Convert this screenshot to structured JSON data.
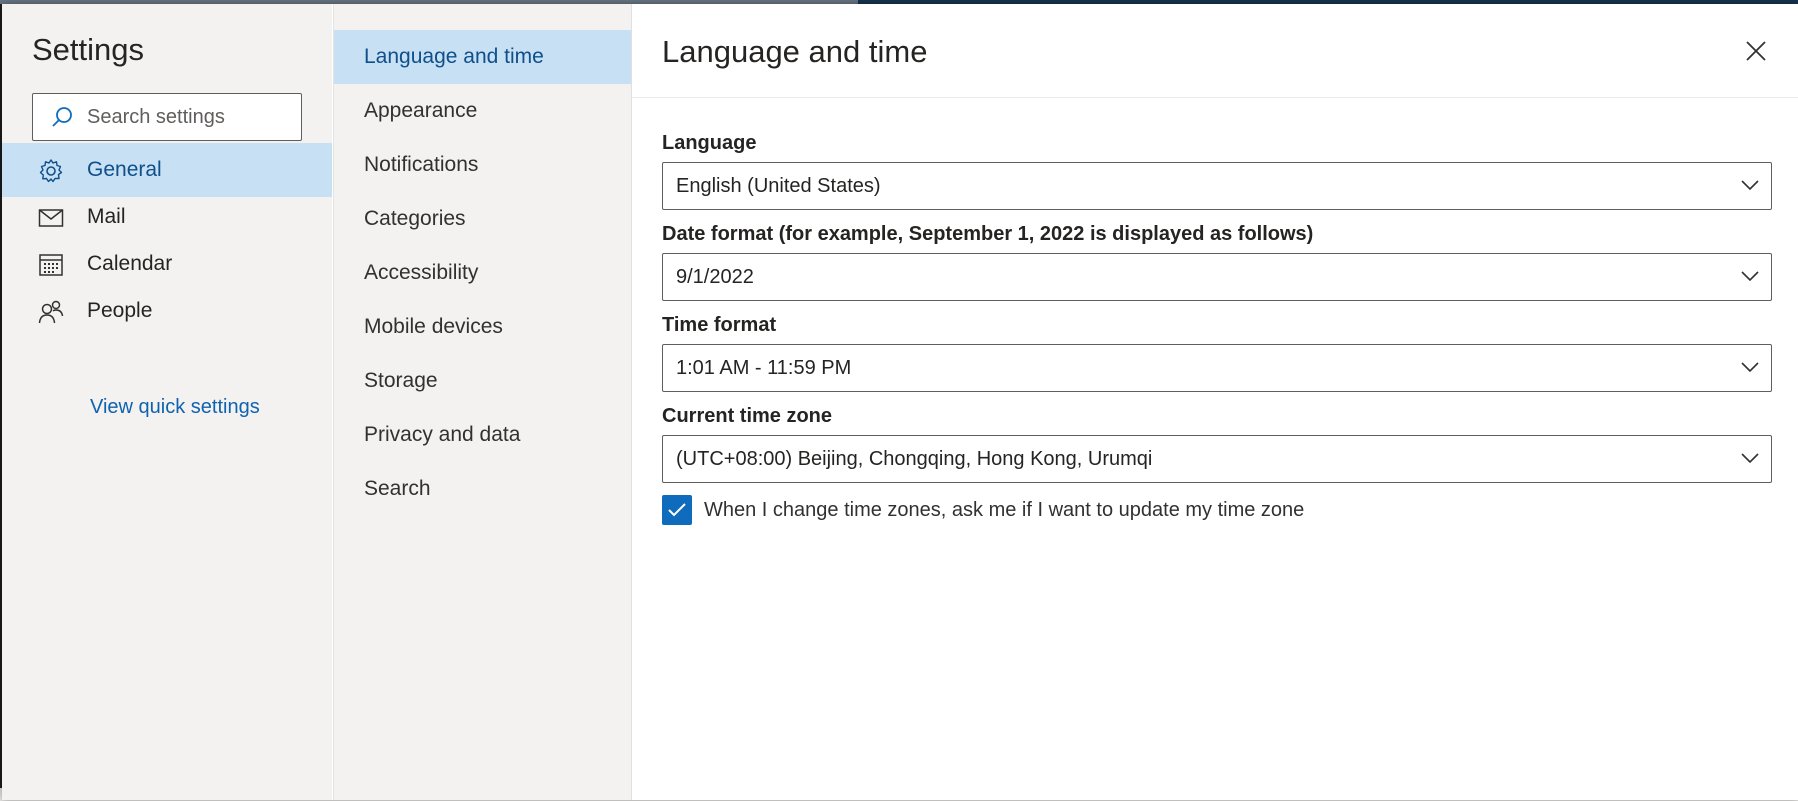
{
  "settings": {
    "title": "Settings",
    "search_placeholder": "Search settings"
  },
  "nav": {
    "items": [
      {
        "label": "General",
        "icon": "gear-icon",
        "selected": true
      },
      {
        "label": "Mail",
        "icon": "mail-icon",
        "selected": false
      },
      {
        "label": "Calendar",
        "icon": "calendar-icon",
        "selected": false
      },
      {
        "label": "People",
        "icon": "people-icon",
        "selected": false
      }
    ],
    "quick_settings_link": "View quick settings"
  },
  "subnav": {
    "items": [
      {
        "label": "Language and time",
        "selected": true
      },
      {
        "label": "Appearance",
        "selected": false
      },
      {
        "label": "Notifications",
        "selected": false
      },
      {
        "label": "Categories",
        "selected": false
      },
      {
        "label": "Accessibility",
        "selected": false
      },
      {
        "label": "Mobile devices",
        "selected": false
      },
      {
        "label": "Storage",
        "selected": false
      },
      {
        "label": "Privacy and data",
        "selected": false
      },
      {
        "label": "Search",
        "selected": false
      }
    ]
  },
  "pane": {
    "title": "Language and time",
    "language": {
      "label": "Language",
      "value": "English (United States)"
    },
    "date_format": {
      "label": "Date format (for example, September 1, 2022 is displayed as follows)",
      "value": "9/1/2022"
    },
    "time_format": {
      "label": "Time format",
      "value": "1:01 AM - 11:59 PM"
    },
    "time_zone": {
      "label": "Current time zone",
      "value": "(UTC+08:00) Beijing, Chongqing, Hong Kong, Urumqi"
    },
    "update_tz_checkbox": {
      "label": "When I change time zones, ask me if I want to update my time zone",
      "checked": true
    }
  },
  "colors": {
    "accent": "#0f6cbd",
    "selected_bg": "#c7e0f4",
    "sidebar_bg": "#f3f2f1",
    "link": "#0f62b0"
  }
}
